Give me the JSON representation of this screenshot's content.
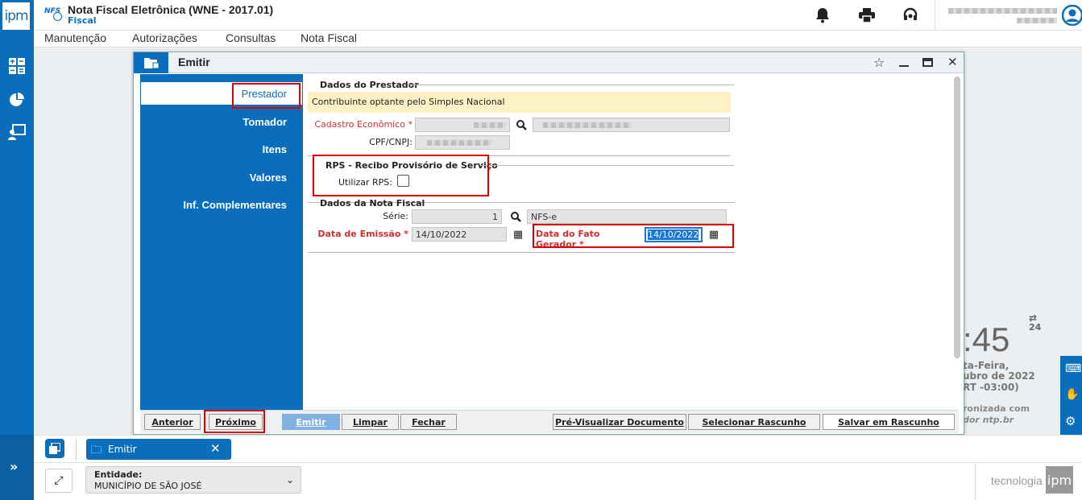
{
  "app": {
    "title": "Nota Fiscal Eletrônica (WNE - 2017.01)",
    "subtitle": "Fiscal",
    "logo_text": "ipm",
    "nfs_badge": "NFS"
  },
  "menu": [
    "Manutenção",
    "Autorizações",
    "Consultas",
    "Nota Fiscal"
  ],
  "window": {
    "title": "Emitir",
    "nav": [
      "Prestador",
      "Tomador",
      "Itens",
      "Valores",
      "Inf. Complementares"
    ],
    "prestador": {
      "section": "Dados do Prestador",
      "notice": "Contribuinte optante pelo Simples Nacional",
      "cadastro_label": "Cadastro Econômico",
      "cpf_label": "CPF/CNPJ:"
    },
    "rps": {
      "section": "RPS - Recibo Provisório de Serviço",
      "utilizar_label": "Utilizar RPS:"
    },
    "nota": {
      "section": "Dados da Nota Fiscal",
      "serie_label": "Série:",
      "serie_value": "1",
      "serie_desc": "NFS-e",
      "emissao_label": "Data de Emissão",
      "emissao_value": "14/10/2022",
      "fato_label": "Data do Fato Gerador",
      "fato_value": "14/10/2022"
    },
    "buttons": {
      "anterior": "Anterior",
      "proximo": "Próximo",
      "emitir": "Emitir",
      "limpar": "Limpar",
      "fechar": "Fechar",
      "pre_visualizar": "Pré-Visualizar Documento",
      "selecionar": "Selecionar Rascunho",
      "salvar": "Salvar em Rascunho"
    }
  },
  "clock": {
    "time": ":45",
    "day": "ta-Feira,",
    "date": "ubro de 2022",
    "tz": "RT -03:00)",
    "sync1": "ronizada com",
    "sync2": "dor ntp.br",
    "format": "24"
  },
  "taskbar": {
    "tab_label": "Emitir"
  },
  "entidade": {
    "label": "Entidade:",
    "value": "MUNICÍPIO DE SÃO JOSÉ"
  },
  "brand": {
    "text": "tecnologia",
    "logo": "ipm"
  },
  "colors": {
    "primary": "#0a6ebd",
    "required": "#d32f2f",
    "highlight": "#d00000"
  }
}
